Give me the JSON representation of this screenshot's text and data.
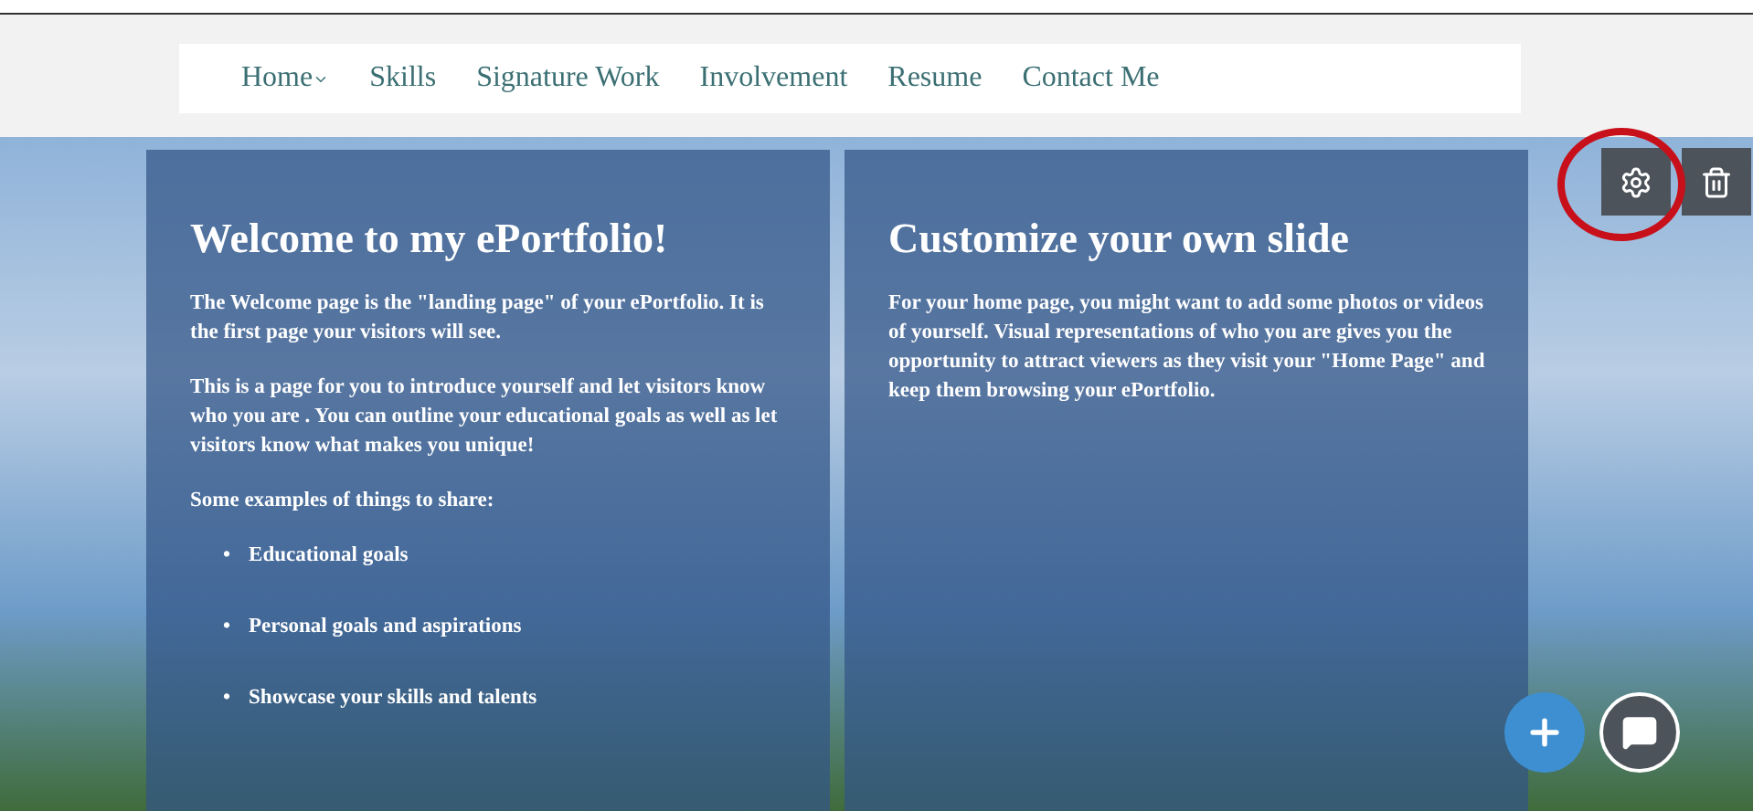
{
  "nav": {
    "items": [
      {
        "label": "Home",
        "has_submenu": true
      },
      {
        "label": "Skills",
        "has_submenu": false
      },
      {
        "label": "Signature Work",
        "has_submenu": false
      },
      {
        "label": "Involvement",
        "has_submenu": false
      },
      {
        "label": "Resume",
        "has_submenu": false
      },
      {
        "label": "Contact Me",
        "has_submenu": false
      }
    ]
  },
  "slides": [
    {
      "title": "Welcome to my ePortfolio!",
      "paragraphs": [
        "The Welcome page is the \"landing page\" of your ePortfolio. It is the first page your visitors will see.",
        " This is a page for you to introduce yourself and let visitors know who you are . You can outline your educational  goals as well as let visitors know what makes you unique!",
        "Some examples of things to share:"
      ],
      "bullets": [
        {
          "marker": "•",
          "text": "Educational goals"
        },
        {
          "marker": "•",
          "text": "Personal goals and aspirations"
        },
        {
          "marker": "•",
          "text": "Showcase your skills and talents"
        }
      ]
    },
    {
      "title": "Customize your own slide",
      "paragraphs": [
        "For your home page, you might want to add some photos or videos of yourself.  Visual representations of who you are gives you the opportunity to attract viewers as they visit your \"Home Page\" and keep them browsing your ePortfolio."
      ]
    }
  ],
  "tools": {
    "settings_highlighted": true
  }
}
